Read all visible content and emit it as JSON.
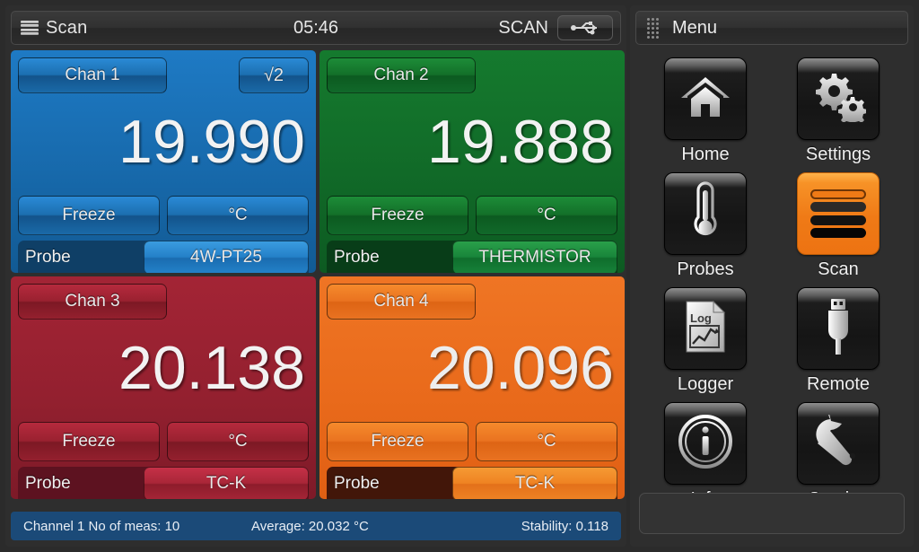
{
  "status_bar": {
    "menu_icon": "hamburger-icon",
    "title": "Scan",
    "time": "05:46",
    "mode": "SCAN",
    "usb_icon": "usb-icon"
  },
  "channels": [
    {
      "name": "Chan 1",
      "value": "19.990",
      "sqrt_label": "√2",
      "freeze_label": "Freeze",
      "unit_label": "°C",
      "probe_label": "Probe",
      "probe_type": "4W-PT25",
      "color": "#1769ab"
    },
    {
      "name": "Chan 2",
      "value": "19.888",
      "freeze_label": "Freeze",
      "unit_label": "°C",
      "probe_label": "Probe",
      "probe_type": "THERMISTOR",
      "color": "#116a28"
    },
    {
      "name": "Chan 3",
      "value": "20.138",
      "freeze_label": "Freeze",
      "unit_label": "°C",
      "probe_label": "Probe",
      "probe_type": "TC-K",
      "color": "#93202f"
    },
    {
      "name": "Chan 4",
      "value": "20.096",
      "freeze_label": "Freeze",
      "unit_label": "°C",
      "probe_label": "Probe",
      "probe_type": "TC-K",
      "color": "#e96a1b"
    }
  ],
  "info_bar": {
    "measurements": "Channel 1 No of meas: 10",
    "average": "Average: 20.032 °C",
    "stability": "Stability: 0.118",
    "background": "#1b4a78"
  },
  "menu": {
    "grip_icon": "grip-dots-icon",
    "title": "Menu",
    "active_accent": "#ef7a16",
    "items": [
      {
        "label": "Home",
        "icon": "home-icon",
        "active": false
      },
      {
        "label": "Settings",
        "icon": "gears-icon",
        "active": false
      },
      {
        "label": "Probes",
        "icon": "thermometer-icon",
        "active": false
      },
      {
        "label": "Scan",
        "icon": "scan-bars-icon",
        "active": true
      },
      {
        "label": "Logger",
        "icon": "log-document-icon",
        "active": false
      },
      {
        "label": "Remote",
        "icon": "usb-plug-icon",
        "active": false
      },
      {
        "label": "Info",
        "icon": "info-circle-icon",
        "active": false
      },
      {
        "label": "Service",
        "icon": "wrench-icon",
        "active": false
      }
    ]
  }
}
